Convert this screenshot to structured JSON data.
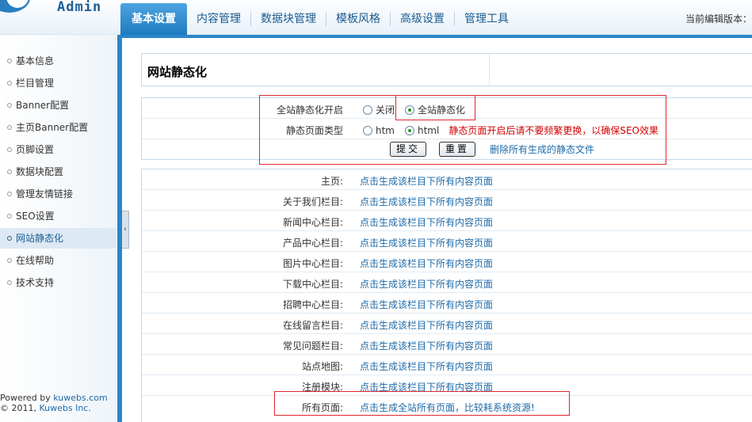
{
  "header": {
    "logo_text": "Admin",
    "nav": [
      {
        "label": "基本设置"
      },
      {
        "label": "内容管理"
      },
      {
        "label": "数据块管理"
      },
      {
        "label": "模板风格"
      },
      {
        "label": "高级设置"
      },
      {
        "label": "管理工具"
      }
    ],
    "active_nav": "基本设置",
    "edit_status": "当前编辑版本："
  },
  "sidebar": {
    "items": [
      {
        "label": "基本信息"
      },
      {
        "label": "栏目管理"
      },
      {
        "label": "Banner配置"
      },
      {
        "label": "主页Banner配置"
      },
      {
        "label": "页脚设置"
      },
      {
        "label": "数据块配置"
      },
      {
        "label": "管理友情链接"
      },
      {
        "label": "SEO设置"
      },
      {
        "label": "网站静态化"
      },
      {
        "label": "在线帮助"
      },
      {
        "label": "技术支持"
      }
    ],
    "active_item": "网站静态化",
    "footer": {
      "powered_prefix": "Powered by ",
      "powered_link": "kuwebs.com",
      "copyright_prefix": "© 2011, ",
      "copyright_link": "Kuwebs Inc."
    },
    "collapse_glyph": "‹"
  },
  "page": {
    "title": "网站静态化"
  },
  "form": {
    "static_label": "全站静态化开启",
    "static_options": [
      {
        "label": "关闭",
        "checked": false
      },
      {
        "label": "全站静态化",
        "checked": true
      }
    ],
    "type_label": "静态页面类型",
    "type_options": [
      {
        "label": "htm",
        "checked": false
      },
      {
        "label": "html",
        "checked": true
      }
    ],
    "warning": "静态页面开启后请不要频繁更换，以确保SEO效果",
    "submit_label": "提交",
    "reset_label": "重置",
    "delete_link": "删除所有生成的静态文件"
  },
  "generate": {
    "rows": [
      {
        "label": "主页:",
        "link": "点击生成该栏目下所有内容页面"
      },
      {
        "label": "关于我们栏目:",
        "link": "点击生成该栏目下所有内容页面"
      },
      {
        "label": "新闻中心栏目:",
        "link": "点击生成该栏目下所有内容页面"
      },
      {
        "label": "产品中心栏目:",
        "link": "点击生成该栏目下所有内容页面"
      },
      {
        "label": "图片中心栏目:",
        "link": "点击生成该栏目下所有内容页面"
      },
      {
        "label": "下载中心栏目:",
        "link": "点击生成该栏目下所有内容页面"
      },
      {
        "label": "招聘中心栏目:",
        "link": "点击生成该栏目下所有内容页面"
      },
      {
        "label": "在线留言栏目:",
        "link": "点击生成该栏目下所有内容页面"
      },
      {
        "label": "常见问题栏目:",
        "link": "点击生成该栏目下所有内容页面"
      },
      {
        "label": "站点地图:",
        "link": "点击生成该栏目下所有内容页面"
      },
      {
        "label": "注册模块:",
        "link": "点击生成该栏目下所有内容页面"
      },
      {
        "label": "所有页面:",
        "link": "点击生成全站所有页面，比较耗系统资源!"
      }
    ]
  },
  "colors": {
    "accent": "#2a86c9",
    "link": "#1d6aa8",
    "warning": "#d40000",
    "highlight_box": "#e0282e"
  }
}
